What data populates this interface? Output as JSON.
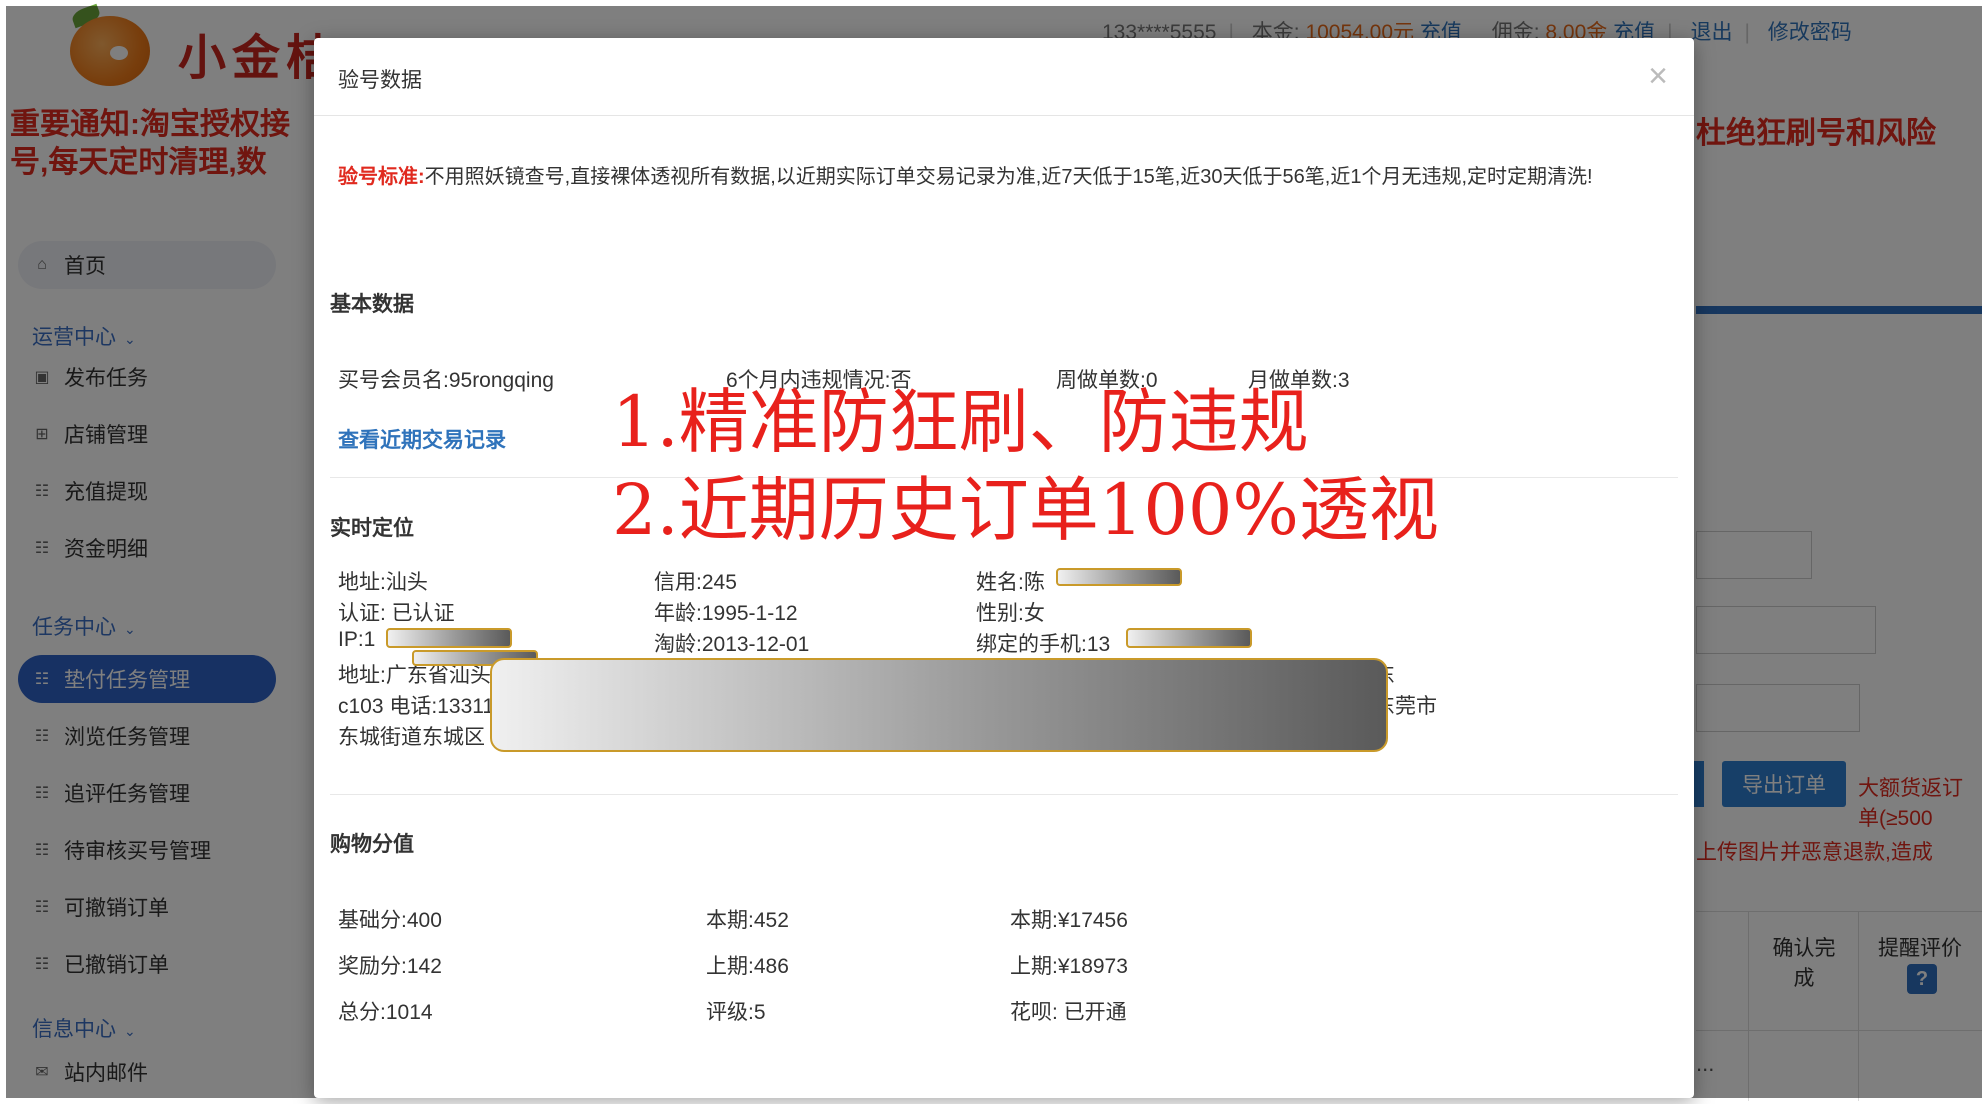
{
  "header": {
    "logo_text": "小金桔",
    "phone": "133****5555",
    "principal_label": "本金:",
    "principal_value": "10054.00元",
    "recharge1": "充值",
    "commission_label": "佣金:",
    "commission_value": "8.00金",
    "recharge2": "充值",
    "logout": "退出",
    "change_password": "修改密码"
  },
  "notice": {
    "line1": "重要通知:淘宝授权接",
    "line2": "号,每天定时清理,数",
    "right": "杜绝狂刷号和风险"
  },
  "sidebar": {
    "home": "首页",
    "groups": [
      "运营中心",
      "任务中心",
      "信息中心"
    ],
    "items": [
      "发布任务",
      "店铺管理",
      "充值提现",
      "资金明细",
      "垫付任务管理",
      "浏览任务管理",
      "追评任务管理",
      "待审核买号管理",
      "可撤销订单",
      "已撤销订单",
      "站内邮件"
    ]
  },
  "right_panel": {
    "export": "导出订单",
    "big_return": "大额货返订单(≥500",
    "upload_warn": "上传图片并恶意退款,造成",
    "confirm": "确认完成",
    "remind": "提醒评价",
    "help": "?",
    "dots": "..."
  },
  "modal": {
    "title": "验号数据",
    "close": "×",
    "standard_label": "验号标准:",
    "standard_text": "不用照妖镜查号,直接裸体透视所有数据,以近期实际订单交易记录为准,近7天低于15笔,近30天低于56笔,近1个月无违规,定时定期清洗!",
    "basic": {
      "title": "基本数据",
      "member": "买号会员名:95rongqing",
      "violation": "6个月内违规情况:否",
      "week": "周做单数:0",
      "month": "月做单数:3",
      "link": "查看近期交易记录"
    },
    "location": {
      "title": "实时定位",
      "address": "地址:汕头",
      "credit": "信用:245",
      "name": "姓名:陈",
      "verify": "认证: 已认证",
      "age": "年龄:1995-1-12",
      "gender": "性别:女",
      "ip": "IP:1",
      "taoage": "淘龄:2013-12-01",
      "phone": "绑定的手机:13",
      "addr_full_1": "地址:广东省汕头",
      "addr_full_1_tail": "东",
      "addr_full_2": "c103 电话:13311",
      "addr_full_2_tail": "东莞市",
      "addr_full_3": "东城街道东城区"
    },
    "shopping": {
      "title": "购物分值",
      "base": "基础分:400",
      "bonus": "奖励分:142",
      "total": "总分:1014",
      "cur_period": "本期:452",
      "prev_period": "上期:486",
      "rating": "评级:5",
      "cur_amount": "本期:¥17456",
      "prev_amount": "上期:¥18973",
      "huabei": "花呗: 已开通"
    }
  },
  "annotations": {
    "line1": "1.精准防狂刷、防违规",
    "line2": "2.近期历史订单100%透视"
  }
}
